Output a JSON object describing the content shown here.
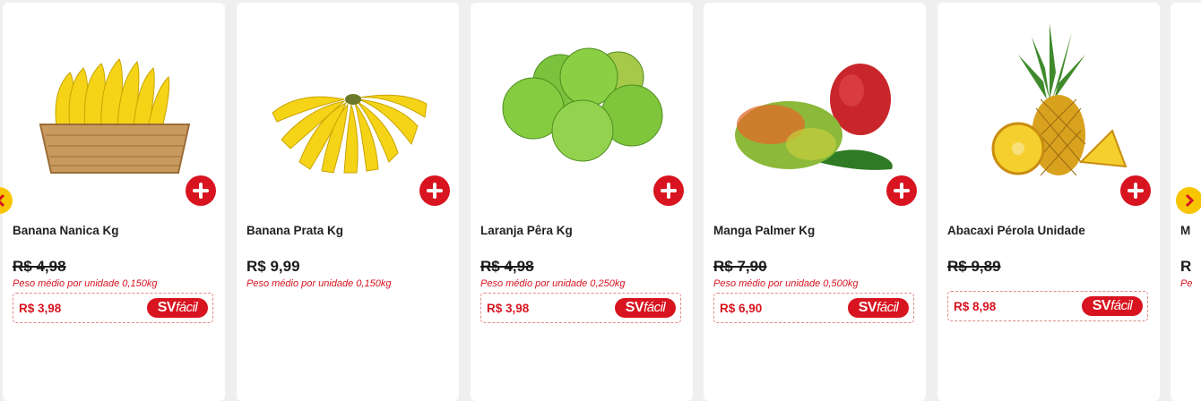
{
  "products": [
    {
      "name": "Banana Nanica Kg",
      "old_price": "R$ 4,98",
      "weight_note": "Peso médio por unidade 0,150kg",
      "promo_price": "R$ 3,98",
      "image": "banana-basket-image"
    },
    {
      "name": "Banana Prata Kg",
      "price": "R$ 9,99",
      "weight_note": "Peso médio por unidade 0,150kg",
      "image": "banana-bunch-image"
    },
    {
      "name": "Laranja Pêra Kg",
      "old_price": "R$ 4,98",
      "weight_note": "Peso médio por unidade 0,250kg",
      "promo_price": "R$ 3,98",
      "image": "oranges-image"
    },
    {
      "name": "Manga Palmer Kg",
      "old_price": "R$ 7,90",
      "weight_note": "Peso médio por unidade 0,500kg",
      "promo_price": "R$ 6,90",
      "image": "mangoes-image"
    },
    {
      "name": "Abacaxi Pérola Unidade",
      "old_price": "R$ 9,89",
      "promo_price": "R$ 8,98",
      "image": "pineapple-image"
    },
    {
      "name": "M",
      "old_price": "R",
      "weight_note": "Pe",
      "image": "partial-product-image"
    }
  ],
  "badge": {
    "sv": "SV",
    "facil": "fácil"
  },
  "colors": {
    "accent": "#d7141f",
    "arrow": "#f7c600",
    "background": "#efefef"
  },
  "icons": {
    "add": "plus-circle-icon",
    "prev": "chevron-left-icon",
    "next": "chevron-right-icon"
  }
}
